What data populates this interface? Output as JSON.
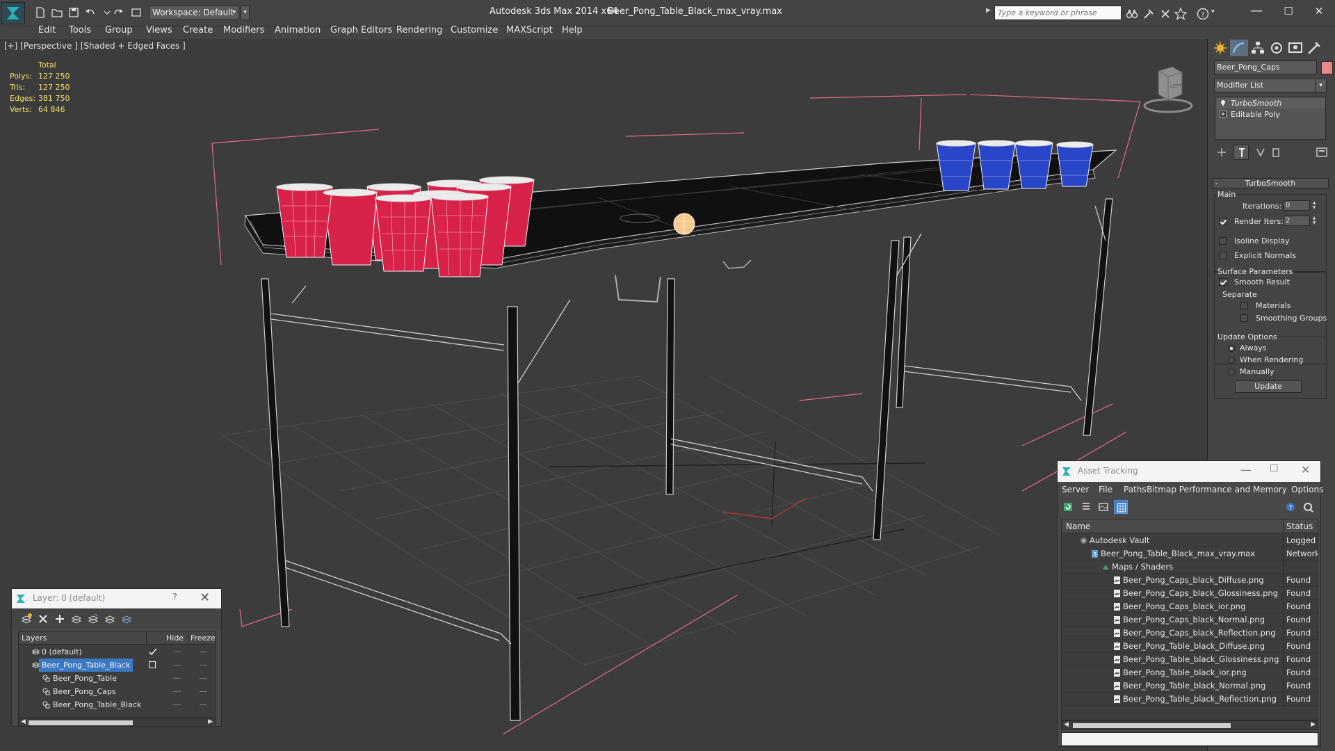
{
  "titlebar": {
    "workspace_label": "Workspace: Default",
    "app_title": "Autodesk 3ds Max  2014 x64",
    "file_title": "Beer_Pong_Table_Black_max_vray.max",
    "search_placeholder": "Type a keyword or phrase",
    "minimize": "—",
    "maximize": "☐",
    "close": "✕"
  },
  "menu": [
    "Edit",
    "Tools",
    "Group",
    "Views",
    "Create",
    "Modifiers",
    "Animation",
    "Graph Editors",
    "Rendering",
    "Customize",
    "MAXScript",
    "Help"
  ],
  "viewport": {
    "label": "[+] [Perspective ] [Shaded + Edged Faces ]",
    "stats": {
      "header": "Total",
      "rows": [
        {
          "label": "Polys:",
          "value": "127 250"
        },
        {
          "label": "Tris:",
          "value": "127 250"
        },
        {
          "label": "Edges:",
          "value": "381 750"
        },
        {
          "label": "Verts:",
          "value": "64 846"
        }
      ]
    },
    "viewcube_label": "LEFT"
  },
  "command_panel": {
    "object_name": "Beer_Pong_Caps",
    "object_color": "#e88888",
    "modifier_list": "Modifier List",
    "stack": [
      {
        "label": "TurboSmooth",
        "italic": true
      },
      {
        "label": "Editable Poly",
        "italic": false
      }
    ],
    "rollout_title": "TurboSmooth",
    "main_group": "Main",
    "iterations_label": "Iterations:",
    "iterations_value": "0",
    "render_iters_label": "Render Iters:",
    "render_iters_value": "2",
    "render_iters_checked": true,
    "isoline_label": "Isoline Display",
    "explicit_normals_label": "Explicit Normals",
    "surface_group": "Surface Parameters",
    "smooth_result_label": "Smooth Result",
    "separate_label": "Separate",
    "materials_label": "Materials",
    "smoothing_groups_label": "Smoothing Groups",
    "update_group": "Update Options",
    "always_label": "Always",
    "when_rendering_label": "When Rendering",
    "manually_label": "Manually",
    "update_button": "Update"
  },
  "layer_dialog": {
    "title": "Layer: 0 (default)",
    "help": "?",
    "close": "✕",
    "columns": [
      "Layers",
      "Hide",
      "Freeze"
    ],
    "rows": [
      {
        "name": "0 (default)",
        "indent": 1,
        "selected": false,
        "current": true
      },
      {
        "name": "Beer_Pong_Table_Black",
        "indent": 1,
        "selected": true,
        "current": false
      },
      {
        "name": "Beer_Pong_Table",
        "indent": 2,
        "selected": false,
        "current": false
      },
      {
        "name": "Beer_Pong_Caps",
        "indent": 2,
        "selected": false,
        "current": false
      },
      {
        "name": "Beer_Pong_Table_Black",
        "indent": 2,
        "selected": false,
        "current": false
      }
    ]
  },
  "asset_tracking": {
    "title": "Asset Tracking",
    "menu": [
      "Server",
      "File",
      "Paths",
      "Bitmap Performance and Memory",
      "Options"
    ],
    "columns": [
      "Name",
      "Status"
    ],
    "rows": [
      {
        "name": "Autodesk Vault",
        "status": "Logged C",
        "indent": 0,
        "kind": "vault"
      },
      {
        "name": "Beer_Pong_Table_Black_max_vray.max",
        "status": "Network",
        "indent": 1,
        "kind": "max"
      },
      {
        "name": "Maps / Shaders",
        "status": "",
        "indent": 2,
        "kind": "folder"
      },
      {
        "name": "Beer_Pong_Caps_black_Diffuse.png",
        "status": "Found",
        "indent": 3,
        "kind": "file"
      },
      {
        "name": "Beer_Pong_Caps_black_Glossiness.png",
        "status": "Found",
        "indent": 3,
        "kind": "file"
      },
      {
        "name": "Beer_Pong_Caps_black_ior.png",
        "status": "Found",
        "indent": 3,
        "kind": "file"
      },
      {
        "name": "Beer_Pong_Caps_black_Normal.png",
        "status": "Found",
        "indent": 3,
        "kind": "file"
      },
      {
        "name": "Beer_Pong_Caps_black_Reflection.png",
        "status": "Found",
        "indent": 3,
        "kind": "file"
      },
      {
        "name": "Beer_Pong_Table_black_Diffuse.png",
        "status": "Found",
        "indent": 3,
        "kind": "file"
      },
      {
        "name": "Beer_Pong_Table_black_Glossiness.png",
        "status": "Found",
        "indent": 3,
        "kind": "file"
      },
      {
        "name": "Beer_Pong_Table_black_ior.png",
        "status": "Found",
        "indent": 3,
        "kind": "file"
      },
      {
        "name": "Beer_Pong_Table_black_Normal.png",
        "status": "Found",
        "indent": 3,
        "kind": "file"
      },
      {
        "name": "Beer_Pong_Table_black_Reflection.png",
        "status": "Found",
        "indent": 3,
        "kind": "file"
      }
    ]
  },
  "colors": {
    "red_cup": "#d8224a",
    "blue_cup": "#2a46c8",
    "selection": "#3a78c4",
    "stats_text": "#f2e36a",
    "bbox": "#e86a8a"
  }
}
